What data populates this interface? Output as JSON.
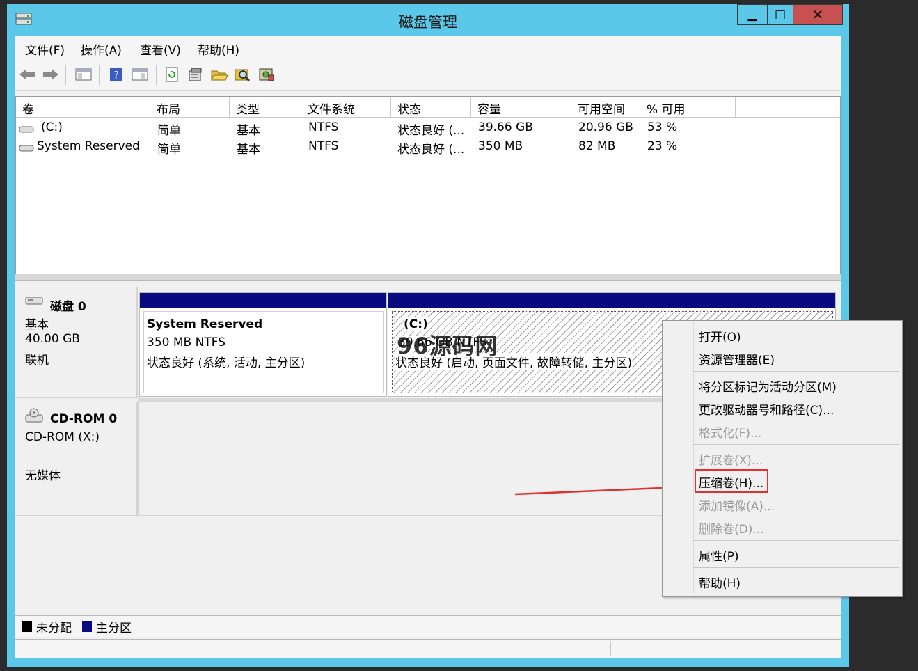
{
  "window": {
    "title": "磁盘管理",
    "min_glyph": "▁",
    "max_glyph": "□",
    "close_glyph": "✕"
  },
  "menubar": {
    "items": [
      "文件(F)",
      "操作(A)",
      "查看(V)",
      "帮助(H)"
    ]
  },
  "toolbar": {
    "icons": [
      "back-icon",
      "forward-icon",
      "console-tree-icon",
      "help-icon",
      "action-pane-icon",
      "refresh-icon",
      "properties-icon",
      "open-icon",
      "explore-icon",
      "disk-settings-icon"
    ]
  },
  "volume_list": {
    "columns": [
      "卷",
      "布局",
      "类型",
      "文件系统",
      "状态",
      "容量",
      "可用空间",
      "% 可用"
    ],
    "rows": [
      [
        "(C:)",
        "简单",
        "基本",
        "NTFS",
        "状态良好 (...",
        "39.66 GB",
        "20.96 GB",
        "53 %"
      ],
      [
        "System Reserved",
        "简单",
        "基本",
        "NTFS",
        "状态良好 (...",
        "350 MB",
        "82 MB",
        "23 %"
      ]
    ]
  },
  "disks": {
    "disk0": {
      "name": "磁盘 0",
      "type": "基本",
      "size": "40.00 GB",
      "status": "联机"
    },
    "cdrom0": {
      "name": "CD-ROM 0",
      "drive": "CD-ROM (X:)",
      "media": "无媒体"
    }
  },
  "partitions": {
    "system_reserved": {
      "name": "System Reserved",
      "size_fs": "350 MB NTFS",
      "status": "状态良好 (系统, 活动, 主分区)"
    },
    "c_drive": {
      "name": "(C:)",
      "size_fs": "39.66 GB NTFS",
      "status": "状态良好 (启动, 页面文件, 故障转储, 主分区)"
    }
  },
  "watermark": "96源码网",
  "legend": {
    "unallocated": "未分配",
    "primary": "主分区"
  },
  "colors": {
    "partition_header": "#0a0a80",
    "highlight_box": "#e03030",
    "arrow": "#e03030"
  },
  "context_menu": {
    "items": [
      {
        "label": "打开(O)",
        "enabled": true
      },
      {
        "label": "资源管理器(E)",
        "enabled": true
      },
      {
        "label": "将分区标记为活动分区(M)",
        "enabled": true
      },
      {
        "label": "更改驱动器号和路径(C)...",
        "enabled": true
      },
      {
        "label": "格式化(F)...",
        "enabled": false
      },
      {
        "label": "扩展卷(X)...",
        "enabled": false
      },
      {
        "label": "压缩卷(H)...",
        "enabled": true,
        "highlighted": true
      },
      {
        "label": "添加镜像(A)...",
        "enabled": false
      },
      {
        "label": "删除卷(D)...",
        "enabled": false
      },
      {
        "label": "属性(P)",
        "enabled": true
      },
      {
        "label": "帮助(H)",
        "enabled": true
      }
    ]
  }
}
